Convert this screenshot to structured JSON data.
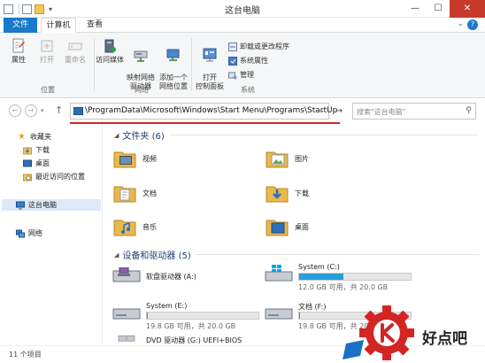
{
  "window": {
    "title": "这台电脑",
    "minimize": "—",
    "maximize": "☐",
    "close": "✕"
  },
  "tabs": {
    "file": "文件",
    "computer": "计算机",
    "view": "查看"
  },
  "ribbon": {
    "location": {
      "label": "位置",
      "properties": "属性",
      "open": "打开",
      "rename": "重命名"
    },
    "network": {
      "label": "网络",
      "media": "访问媒体",
      "map_drive": "映射网络\n驱动器",
      "add_location": "添加一个\n网络位置"
    },
    "system": {
      "label": "系统",
      "control_panel": "打开\n控制面板",
      "uninstall": "卸载或更改程序",
      "sys_props": "系统属性",
      "manage": "管理"
    }
  },
  "address": {
    "path": "\\ProgramData\\Microsoft\\Windows\\Start Menu\\Programs\\StartUp",
    "search_placeholder": "搜索\"这台电脑\""
  },
  "nav": {
    "favorites": "收藏夹",
    "downloads": "下载",
    "desktop": "桌面",
    "recent": "最近访问的位置",
    "this_pc": "这台电脑",
    "network": "网络"
  },
  "folders_header": "文件夹 (6)",
  "folders": [
    {
      "name": "视频",
      "icon": "video-folder"
    },
    {
      "name": "图片",
      "icon": "pictures-folder"
    },
    {
      "name": "文档",
      "icon": "documents-folder"
    },
    {
      "name": "下载",
      "icon": "downloads-folder"
    },
    {
      "name": "音乐",
      "icon": "music-folder"
    },
    {
      "name": "桌面",
      "icon": "desktop-folder"
    }
  ],
  "drives_header": "设备和驱动器 (5)",
  "drives": [
    {
      "name": "软盘驱动器 (A:)",
      "icon": "floppy-drive",
      "size": "",
      "used_fraction": null
    },
    {
      "name": "System (C:)",
      "icon": "windows-drive",
      "size": "12.0 GB 可用，共 20.0 GB",
      "used_fraction": 0.4
    },
    {
      "name": "System (E:)",
      "icon": "hard-drive",
      "size": "19.8 GB 可用，共 20.0 GB",
      "used_fraction": 0.01
    },
    {
      "name": "文档 (F:)",
      "icon": "hard-drive",
      "size": "19.8 GB 可用，共 20.0 GB",
      "used_fraction": 0.01
    },
    {
      "name": "DVD 驱动器 (G:) UEFI+BIOS",
      "icon": "dvd-drive",
      "size": "",
      "used_fraction": null
    }
  ],
  "status": {
    "count": "11 个项目"
  },
  "watermark": {
    "text": "好点吧"
  },
  "colors": {
    "accent": "#1979ca",
    "close": "#c7392b",
    "highlight_line": "#d42424",
    "drive_bar": "#26a0da"
  }
}
